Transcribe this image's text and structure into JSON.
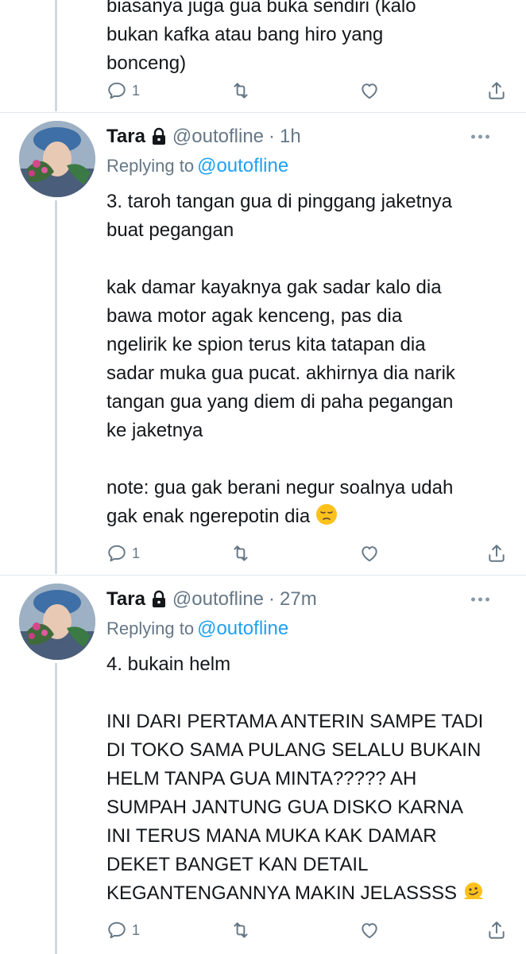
{
  "tweets": [
    {
      "text": "biasanya juga gua buka sendiri (kalo\nbukan kafka atau bang hiro yang\nbonceng)",
      "reply_count": "1"
    },
    {
      "name": "Tara",
      "handle": "@outofline",
      "dot": "·",
      "time": "1h",
      "replying_prefix": "Replying to",
      "replying_to": "@outofline",
      "text": "3. taroh tangan gua di pinggang jaketnya\nbuat pegangan\n\nkak damar kayaknya gak sadar kalo dia\nbawa motor agak kenceng, pas dia\nngelirik ke spion terus kita tatapan dia\nsadar muka gua pucat. akhirnya dia narik\ntangan gua yang diem di paha pegangan\nke jaketnya\n\nnote: gua gak berani negur soalnya udah\ngak enak ngerepotin dia",
      "emoji": "pensive-face",
      "reply_count": "1"
    },
    {
      "name": "Tara",
      "handle": "@outofline",
      "dot": "·",
      "time": "27m",
      "replying_prefix": "Replying to",
      "replying_to": "@outofline",
      "text": "4. bukain helm\n\nINI DARI PERTAMA ANTERIN SAMPE TADI\nDI TOKO SAMA PULANG SELALU BUKAIN\nHELM TANPA GUA MINTA????? AH\nSUMPAH JANTUNG GUA DISKO KARNA\nINI TERUS MANA MUKA KAK DAMAR\nDEKET BANGET KAN DETAIL\nKEGANTENGANNYA MAKIN JELASSSS",
      "emoji": "melting-face",
      "reply_count": "1"
    }
  ],
  "icons": {
    "reply": "reply-icon",
    "retweet": "retweet-icon",
    "like": "heart-icon",
    "share": "share-icon",
    "lock": "lock-icon",
    "more": "more-icon"
  },
  "colors": {
    "accent": "#1da1f2",
    "muted": "#657786",
    "thread_line": "#cfd9de"
  }
}
